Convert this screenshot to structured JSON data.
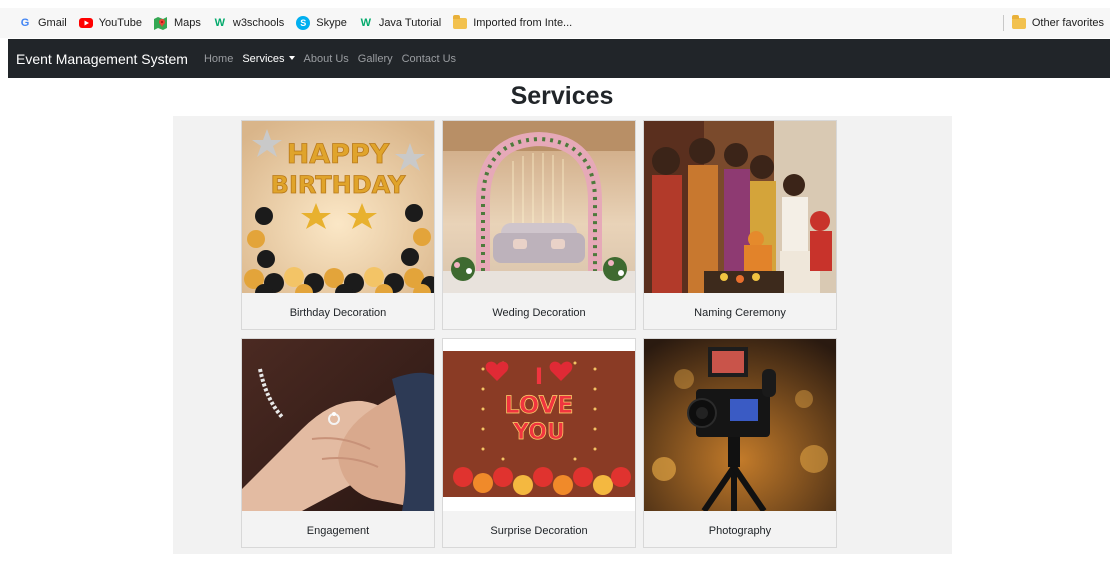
{
  "bookmarks": {
    "items": [
      {
        "label": "Gmail",
        "icon": "google-icon"
      },
      {
        "label": "YouTube",
        "icon": "youtube-icon"
      },
      {
        "label": "Maps",
        "icon": "maps-icon"
      },
      {
        "label": "w3schools",
        "icon": "w3schools-icon"
      },
      {
        "label": "Skype",
        "icon": "skype-icon"
      },
      {
        "label": "Java Tutorial",
        "icon": "w3schools-icon"
      },
      {
        "label": "Imported from Inte...",
        "icon": "folder-icon"
      }
    ],
    "other": "Other favorites"
  },
  "navbar": {
    "brand": "Event Management System",
    "links": [
      "Home",
      "Services",
      "About Us",
      "Gallery",
      "Contact Us"
    ],
    "active": "Services"
  },
  "page": {
    "title": "Services"
  },
  "services": [
    {
      "title": "Birthday Decoration",
      "image": "birthday-balloons-image"
    },
    {
      "title": "Weding Decoration",
      "image": "wedding-arch-image"
    },
    {
      "title": "Naming Ceremony",
      "image": "naming-ceremony-image"
    },
    {
      "title": "Engagement",
      "image": "holding-hands-image"
    },
    {
      "title": "Surprise Decoration",
      "image": "love-balloons-image"
    },
    {
      "title": "Photography",
      "image": "video-camera-image"
    }
  ],
  "colors": {
    "navbar_bg": "#212529",
    "panel_bg": "#f2f2f2",
    "card_bg": "#f3f3f3"
  }
}
